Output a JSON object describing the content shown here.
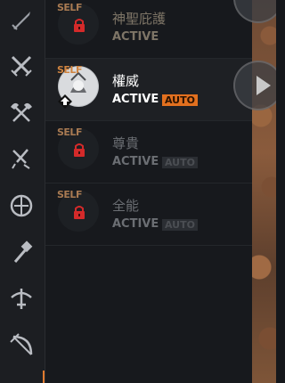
{
  "sidebar": {
    "items": [
      {
        "icon": "sword-icon"
      },
      {
        "icon": "crossed-swords-icon"
      },
      {
        "icon": "crossed-axes-icon"
      },
      {
        "icon": "crossed-daggers-icon"
      },
      {
        "icon": "shield-icon"
      },
      {
        "icon": "hammer-icon"
      },
      {
        "icon": "crossbow-icon"
      },
      {
        "icon": "bow-icon"
      }
    ]
  },
  "skills": [
    {
      "tag": "SELF",
      "name": "神聖庇護",
      "status": "ACTIVE",
      "auto": ""
    },
    {
      "tag": "SELF",
      "name": "權威",
      "status": "ACTIVE",
      "auto": "AUTO"
    },
    {
      "tag": "SELF",
      "name": "尊貴",
      "status": "ACTIVE",
      "auto": "AUTO"
    },
    {
      "tag": "SELF",
      "name": "全能",
      "status": "ACTIVE",
      "auto": "AUTO"
    }
  ],
  "colors": {
    "accent": "#e2701f",
    "lock": "#d42a2a"
  }
}
